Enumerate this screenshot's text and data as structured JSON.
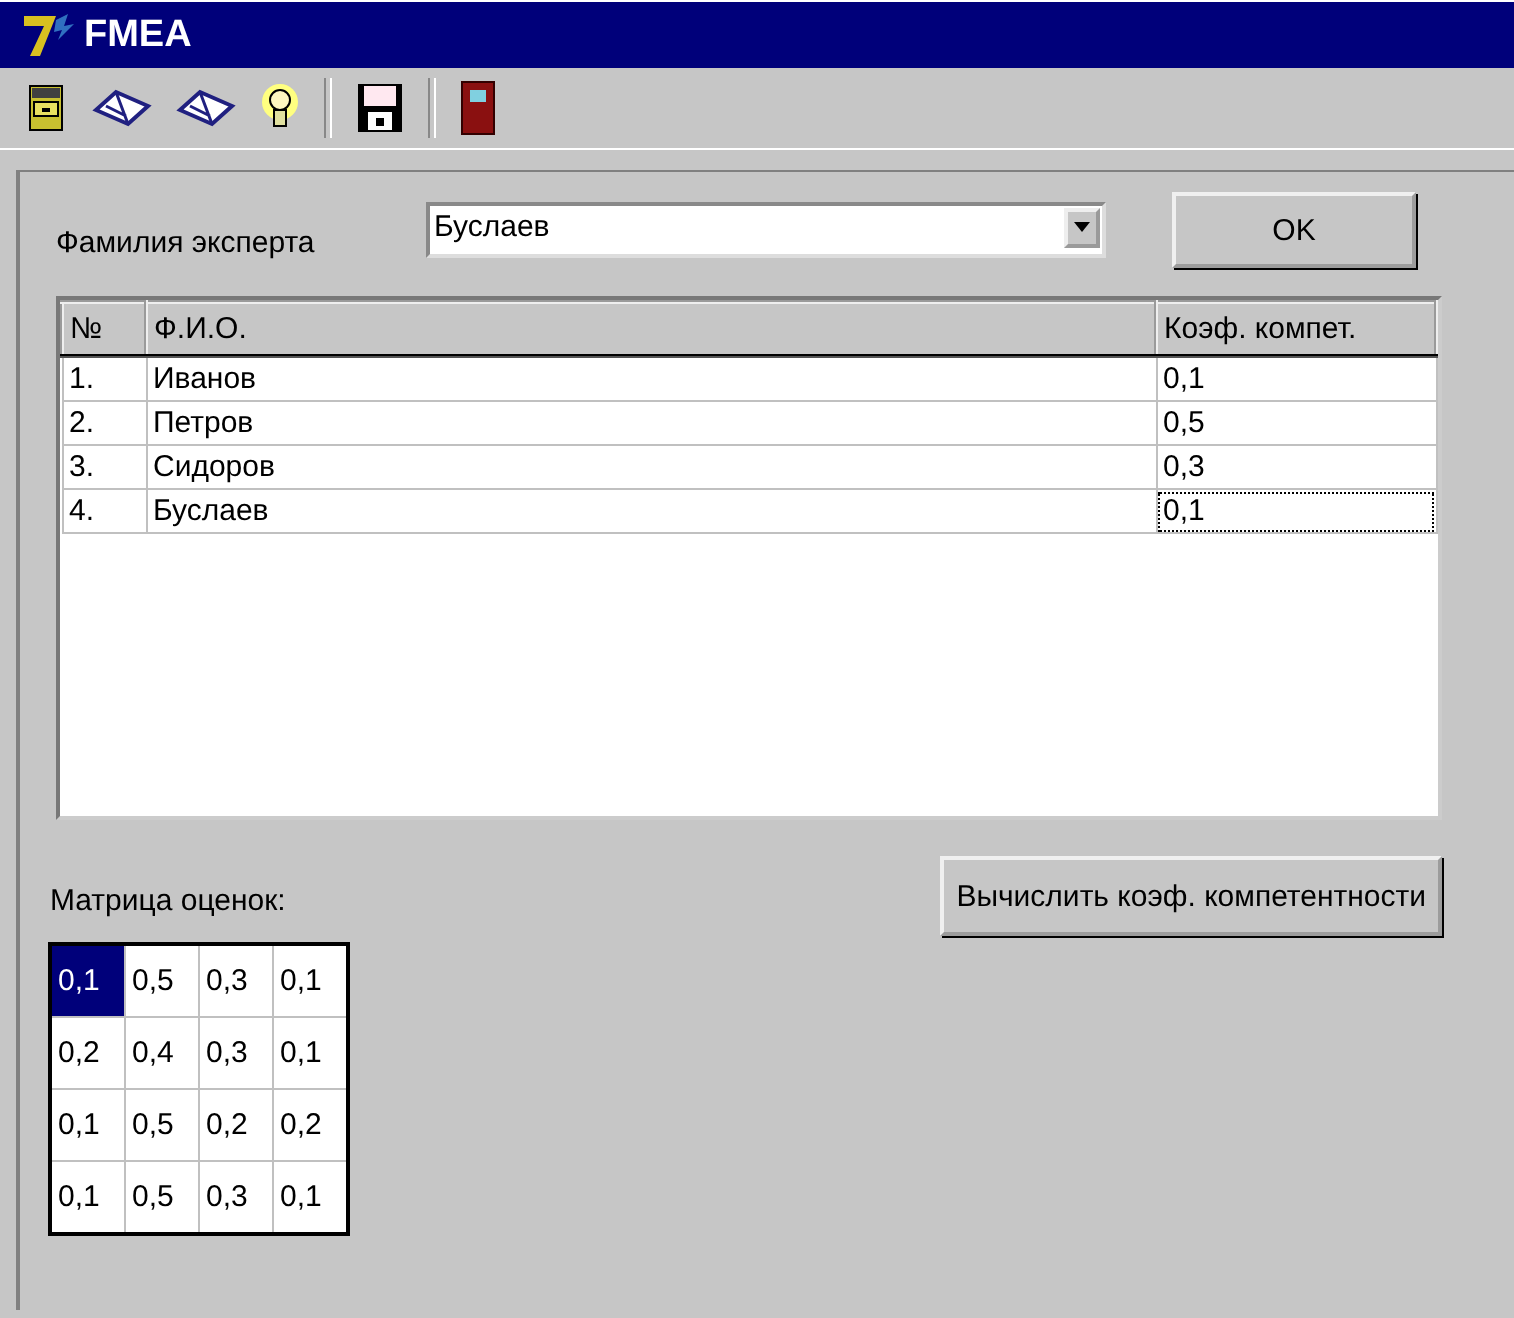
{
  "window": {
    "title": "FMEA"
  },
  "toolbar": [
    {
      "kind": "cabinet"
    },
    {
      "kind": "book"
    },
    {
      "kind": "book"
    },
    {
      "kind": "bulb"
    },
    {
      "kind": "separator"
    },
    {
      "kind": "floppy"
    },
    {
      "kind": "separator"
    },
    {
      "kind": "door"
    }
  ],
  "expert": {
    "label": "Фамилия эксперта",
    "value": "Буслаев"
  },
  "ok_button": "OK",
  "table": {
    "columns": [
      "№",
      "Ф.И.О.",
      "Коэф. компет."
    ],
    "rows": [
      {
        "cells": [
          "1.",
          "Иванов",
          "0,1"
        ],
        "focused": false
      },
      {
        "cells": [
          "2.",
          "Петров",
          "0,5"
        ],
        "focused": false
      },
      {
        "cells": [
          "3.",
          "Сидоров",
          "0,3"
        ],
        "focused": false
      },
      {
        "cells": [
          "4.",
          "Буслаев",
          "0,1"
        ],
        "focused": true
      }
    ]
  },
  "matrix": {
    "label": "Матрица оценок:",
    "rows": [
      [
        {
          "value": "0,1",
          "selected": true
        },
        {
          "value": "0,5",
          "selected": false
        },
        {
          "value": "0,3",
          "selected": false
        },
        {
          "value": "0,1",
          "selected": false
        }
      ],
      [
        {
          "value": "0,2",
          "selected": false
        },
        {
          "value": "0,4",
          "selected": false
        },
        {
          "value": "0,3",
          "selected": false
        },
        {
          "value": "0,1",
          "selected": false
        }
      ],
      [
        {
          "value": "0,1",
          "selected": false
        },
        {
          "value": "0,5",
          "selected": false
        },
        {
          "value": "0,2",
          "selected": false
        },
        {
          "value": "0,2",
          "selected": false
        }
      ],
      [
        {
          "value": "0,1",
          "selected": false
        },
        {
          "value": "0,5",
          "selected": false
        },
        {
          "value": "0,3",
          "selected": false
        },
        {
          "value": "0,1",
          "selected": false
        }
      ]
    ]
  },
  "compute_button": "Вычислить коэф. компетентности"
}
